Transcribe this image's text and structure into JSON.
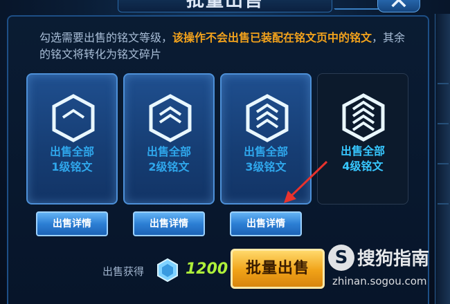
{
  "dialog": {
    "title": "批量出售",
    "close_symbol": "✕",
    "notice_plain_1": "勾选需要出售的铭文等级，",
    "notice_highlight": "该操作不会出售已装配在铭文页中的铭文",
    "notice_plain_2": "，其余的铭文将转化为铭文碎片"
  },
  "cards": [
    {
      "line1": "出售全部",
      "line2": "1级铭文",
      "icon": "hexagon-level-1-icon",
      "state": "selected"
    },
    {
      "line1": "出售全部",
      "line2": "2级铭文",
      "icon": "hexagon-level-2-icon",
      "state": "selected"
    },
    {
      "line1": "出售全部",
      "line2": "3级铭文",
      "icon": "hexagon-level-3-icon",
      "state": "selected"
    },
    {
      "line1": "出售全部",
      "line2": "4级铭文",
      "icon": "hexagon-level-4-icon",
      "state": "unselected"
    }
  ],
  "detail_button_label": "出售详情",
  "footer": {
    "gain_label": "出售获得",
    "gain_icon": "crystal-icon",
    "gain_value": "1200",
    "sell_button": "批量出售"
  },
  "watermark": {
    "logo": "S",
    "text": "搜狗指南",
    "url": "zhinan.sogou.com"
  },
  "colors": {
    "accent_gold": "#f2a21c",
    "card_text_blue": "#2fa7ec",
    "gain_green": "#aef03a"
  }
}
